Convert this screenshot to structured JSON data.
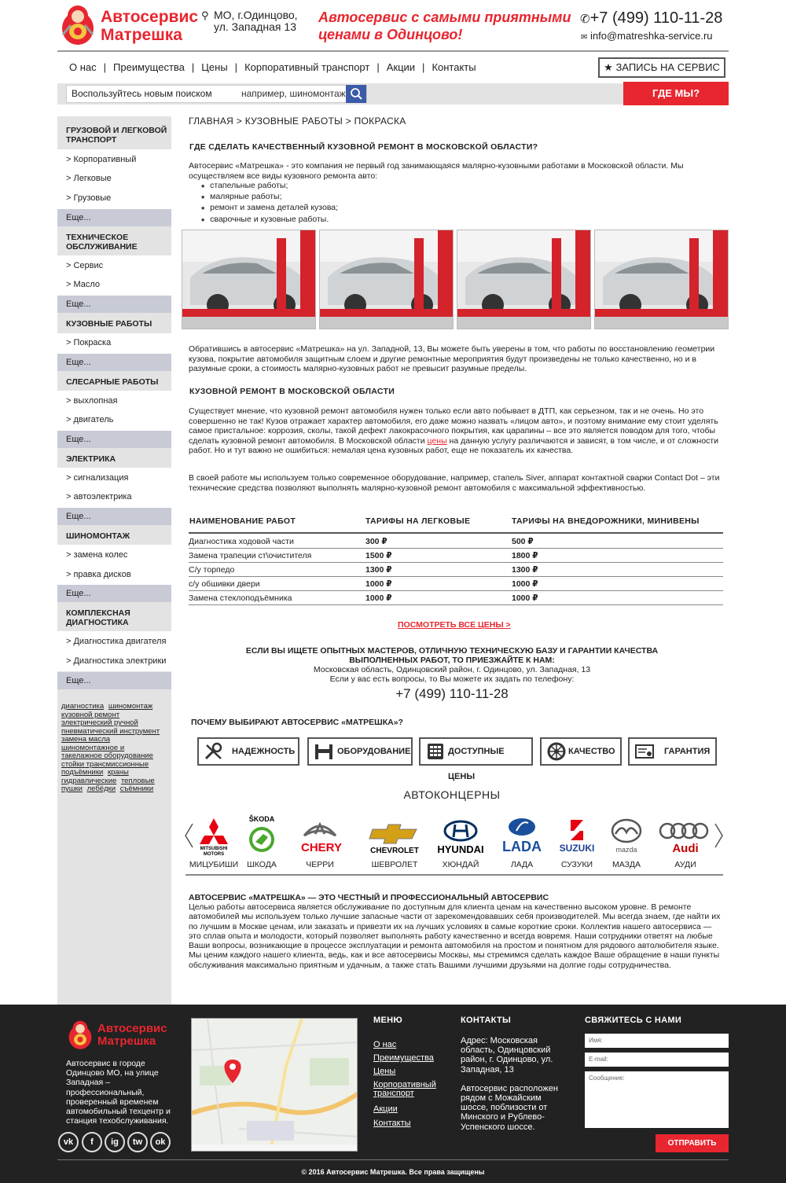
{
  "header": {
    "logo_line1": "Автосервис",
    "logo_line2": "Матрешка",
    "address": "МО, г.Одинцово, ул. Западная 13",
    "slogan": "Автосервис с самыми приятными ценами в Одинцово!",
    "phone": "+7 (499) 110-11-28",
    "email": "info@matreshka-service.ru"
  },
  "nav": {
    "items": [
      "О нас",
      "Преимущества",
      "Цены",
      "Корпоративный транспорт",
      "Акции",
      "Контакты"
    ],
    "book_button": "ЗАПИСЬ НА СЕРВИС"
  },
  "search": {
    "label": "Воспользуйтесь новым поиском",
    "placeholder": "например, шиномонтаж",
    "where_button": "ГДЕ МЫ?"
  },
  "sidebar": {
    "sections": [
      {
        "title": "ГРУЗОВОЙ И ЛЕГКОВОЙ ТРАНСПОРТ",
        "items": [
          "> Корпоративный",
          "> Легковые",
          "> Грузовые"
        ],
        "more": "Еще..."
      },
      {
        "title": "ТЕХНИЧЕСКОЕ ОБСЛУЖИВАНИЕ",
        "items": [
          "> Сервис",
          "> Масло"
        ],
        "more": "Еще..."
      },
      {
        "title": "КУЗОВНЫЕ РАБОТЫ",
        "items": [
          "> Покраска"
        ],
        "more": "Еще..."
      },
      {
        "title": "СЛЕСАРНЫЕ РАБОТЫ",
        "items": [
          "> выхлопная",
          "> двигатель"
        ],
        "more": "Еще..."
      },
      {
        "title": "ЭЛЕКТРИКА",
        "items": [
          "> сигнализация",
          "> автоэлектрика"
        ],
        "more": "Еще..."
      },
      {
        "title": "ШИНОМОНТАЖ",
        "items": [
          "> замена колес",
          "> правка дисков"
        ],
        "more": "Еще..."
      },
      {
        "title": "КОМПЛЕКСНАЯ ДИАГНОСТИКА",
        "items": [
          "> Диагностика двигателя",
          "> Диагностика электрики"
        ],
        "more": "Еще..."
      }
    ],
    "tags": [
      "диагностика",
      "шиномонтаж",
      "кузовной ремонт",
      "электрический ручной",
      "пневматический инструмент",
      "замена масла",
      "шиномонтажное и такелажное оборудование",
      "стойки трансмиссионные",
      "подъёмники",
      "краны гидравлические",
      "тепловые пушки",
      "лебёдки",
      "съёмники"
    ]
  },
  "main": {
    "breadcrumb": "ГЛАВНАЯ > КУЗОВНЫЕ РАБОТЫ > ПОКРАСКА",
    "h1": "ГДЕ СДЕЛАТЬ КАЧЕСТВЕННЫЙ КУЗОВНОЙ РЕМОНТ В МОСКОВСКОЙ ОБЛАСТИ?",
    "intro": "Автосервис «Матрешка» - это компания не первый год занимающаяся малярно-кузовными работами в Московской области. Мы осуществляем все виды кузовного ремонта авто:",
    "bullets": [
      "стапельные работы;",
      "малярные работы;",
      "ремонт и замена деталей кузова;",
      "сварочные и кузовные работы."
    ],
    "p2": "Обратившись в автосервис «Матрешка» на ул. Западной, 13, Вы можете быть уверены в том, что работы по восстановлению геометрии кузова, покрытие автомобиля защитным слоем и другие ремонтные мероприятия будут произведены не только качественно, но и в разумные сроки, а стоимость малярно-кузовных работ не превысит разумные пределы.",
    "h2": "КУЗОВНОЙ РЕМОНТ В МОСКОВСКОЙ ОБЛАСТИ",
    "p3a": "Существует мнение, что кузовной ремонт автомобиля нужен только если авто побывает в ДТП, как серьезном, так и не очень. Но это совершенно не так! Кузов отражает характер автомобиля, его даже можно назвать «лицом авто», и поэтому внимание ему стоит уделять самое пристальное: коррозия, сколы, такой дефект лакокрасочного покрытия, как царапины – все это является поводом для того, чтобы сделать кузовной ремонт автомобиля.  В Московской области ",
    "p3link": "цены",
    "p3b": " на данную услугу различаются и зависят, в том числе, и от сложности работ. Но и тут важно не ошибиться: немалая цена кузовных работ, еще не показатель их качества.",
    "p4": "В своей работе мы используем только современное оборудование, например, стапель Siver, аппарат контактной сварки Contact Dot – эти технические средства позволяют выполнять малярно-кузовной ремонт автомобиля с максимальной эффективностью.",
    "table": {
      "headers": [
        "НАИМЕНОВАНИЕ РАБОТ",
        "ТАРИФЫ  НА ЛЕГКОВЫЕ",
        "ТАРИФЫ  НА ВНЕДОРОЖНИКИ, МИНИВЕНЫ"
      ],
      "rows": [
        [
          "Диагностика ходовой части",
          "300 ₽",
          "500 ₽"
        ],
        [
          "Замена трапеции ст\\очистителя",
          "1500 ₽",
          "1800 ₽"
        ],
        [
          "С/у торпедо",
          "1300 ₽",
          "1300 ₽"
        ],
        [
          "с/у обшивки двери",
          "1000 ₽",
          "1000 ₽"
        ],
        [
          "Замена стеклоподъёмника",
          "1000 ₽",
          "1000 ₽"
        ]
      ]
    },
    "all_prices_link": "ПОСМОТРЕТЬ ВСЕ ЦЕНЫ >",
    "cta_line1": "ЕСЛИ ВЫ ИЩЕТЕ ОПЫТНЫХ МАСТЕРОВ, ОТЛИЧНУЮ ТЕХНИЧЕСКУЮ БАЗУ И ГАРАНТИИ КАЧЕСТВА",
    "cta_line2": "ВЫПОЛНЕННЫХ РАБОТ, ТО ПРИЕЗЖАЙТЕ К НАМ:",
    "cta_address": "Московская область, Одинцовский район, г. Одинцово, ул. Западная, 13",
    "cta_question": "Если у вас есть вопросы, то Вы можете их задать по телефону:",
    "cta_phone": "+7 (499) 110-11-28",
    "why_title": "ПОЧЕМУ ВЫБИРАЮТ АВТОСЕРВИС «МАТРЕШКА»?",
    "features": [
      {
        "label": "НАДЕЖНОСТЬ",
        "icon": "tools-icon"
      },
      {
        "label": "ОБОРУДОВАНИЕ",
        "icon": "lift-icon"
      },
      {
        "label": "ДОСТУПНЫЕ ЦЕНЫ",
        "icon": "calculator-icon"
      },
      {
        "label": "КАЧЕСТВО",
        "icon": "wheel-icon"
      },
      {
        "label": "ГАРАНТИЯ",
        "icon": "certificate-icon"
      }
    ],
    "brands_title": "АВТОКОНЦЕРНЫ",
    "brands": [
      {
        "name": "МИЦУБИШИ",
        "logo_text": "MITSUBISHI MOTORS",
        "color": "#e60012"
      },
      {
        "name": "ШКОДА",
        "logo_text": "ŠKODA",
        "color": "#4ba82e"
      },
      {
        "name": "ЧЕРРИ",
        "logo_text": "CHERY",
        "color": "#e60012"
      },
      {
        "name": "ШЕВРОЛЕТ",
        "logo_text": "CHEVROLET",
        "color": "#d4a017"
      },
      {
        "name": "ХЮНДАЙ",
        "logo_text": "HYUNDAI",
        "color": "#002c5f"
      },
      {
        "name": "ЛАДА",
        "logo_text": "LADA",
        "color": "#1a4f9c"
      },
      {
        "name": "СУЗУКИ",
        "logo_text": "SUZUKI",
        "color": "#1c3f94"
      },
      {
        "name": "МАЗДА",
        "logo_text": "mazda",
        "color": "#333333"
      },
      {
        "name": "АУДИ",
        "logo_text": "Audi",
        "color": "#c00000"
      }
    ],
    "about_title": "АВТОСЕРВИС «МАТРЕШКА» — ЭТО ЧЕСТНЫЙ И ПРОФЕССИОНАЛЬНЫЙ АВТОСЕРВИС",
    "about_text": "Целью работы автосервиса является обслуживание по доступным для клиента ценам на качественно высоком уровне. В ремонте автомобилей мы используем только лучшие запасные части от зарекомендовавших себя производителей. Мы всегда знаем, где найти их по лучшим в Москве ценам, или заказать и привезти их на лучших условиях в самые короткие сроки. Коллектив нашего автосервиса — это сплав опыта и молодости, который позволяет выполнять работу качественно и всегда вовремя. Наши сотрудники ответят на любые Ваши вопросы, возникающие в процессе эксплуатации и ремонта автомобиля на простом и понятном для рядового автолюбителя языке. Мы ценим каждого нашего клиента, ведь, как и все автосервисы Москвы, мы стремимся сделать каждое Ваше обращение в наши пункты обслуживания максимально приятным и удачным, а также стать Вашими лучшими друзьями на долгие годы сотрудничества."
  },
  "footer": {
    "logo_line1": "Автосервис",
    "logo_line2": "Матрешка",
    "desc": "Автосервис в городе Одинцово МО, на улице Западная – профессиональный, проверенный временем автомобильный техцентр и станция техобслуживания.",
    "social": [
      "vk",
      "f",
      "ig",
      "tw",
      "ok"
    ],
    "menu_title": "МЕНЮ",
    "menu": [
      "О нас",
      "Преимущества",
      "Цены",
      "Корпоративный транспорт",
      "Акции",
      "Контакты"
    ],
    "contacts_title": "КОНТАКТЫ",
    "contacts_address": "Адрес: Московская область, Одинцовский район, г. Одинцово, ул. Западная, 13",
    "contacts_note": "Автосервис расположен рядом с Можайским шоссе, поблизости от Минского и Рублево-Успенского шоссе.",
    "form_title": "СВЯЖИТЕСЬ С НАМИ",
    "form_name": "Имя:",
    "form_email": "E-mail:",
    "form_message": "Сообщение:",
    "form_send": "ОТПРАВИТЬ",
    "copyright": "© 2016 Автосервис Матрешка. Все права защищены",
    "colors": {
      "accent": "#e8262f",
      "footer_bg": "#222222",
      "sidebar_bg": "#e3e3e3",
      "more_bg": "#c8cbd6"
    }
  }
}
